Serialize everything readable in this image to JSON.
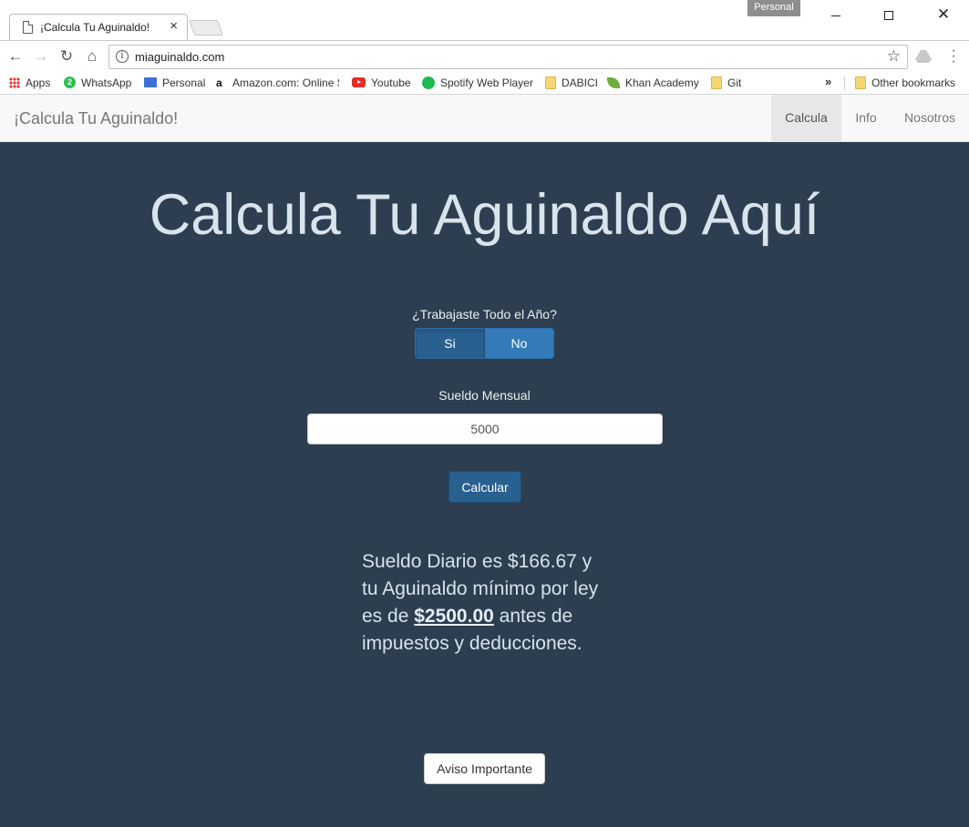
{
  "browser": {
    "tab_title": "¡Calcula Tu Aguinaldo!",
    "tab_close": "×",
    "profile_label": "Personal",
    "url": "miaguinaldo.com",
    "bookmarks": [
      {
        "label": "Apps",
        "icon": "apps-grid-icon"
      },
      {
        "label": "WhatsApp",
        "icon": "whatsapp-icon"
      },
      {
        "label": "Personal",
        "icon": "mail-icon"
      },
      {
        "label": "Amazon.com: Online S",
        "icon": "amazon-icon"
      },
      {
        "label": "Youtube",
        "icon": "youtube-icon"
      },
      {
        "label": "Spotify Web Player",
        "icon": "spotify-icon"
      },
      {
        "label": "DABICI",
        "icon": "folder-icon"
      },
      {
        "label": "Khan Academy",
        "icon": "khan-leaf-icon"
      },
      {
        "label": "Git",
        "icon": "folder-icon"
      }
    ],
    "bookmarks_more": "»",
    "other_bookmarks": "Other bookmarks"
  },
  "site": {
    "brand": "¡Calcula Tu Aguinaldo!",
    "nav": [
      "Calcula",
      "Info",
      "Nosotros"
    ],
    "active_nav": "Calcula"
  },
  "main": {
    "title": "Calcula Tu Aguinaldo Aquí",
    "question": "¿Trabajaste Todo el Año?",
    "toggle_yes": "Si",
    "toggle_no": "No",
    "selected": "Si",
    "salary_label": "Sueldo Mensual",
    "salary_value": "5000",
    "calculate": "Calcular",
    "result_prefix": "Sueldo Diario es $166.67 y tu Aguinaldo mínimo por ley es de ",
    "result_amount": "$2500.00",
    "result_suffix": " antes de impuestos y deducciones.",
    "notice_button": "Aviso Importante"
  },
  "colors": {
    "page_bg": "#2c3e50",
    "primary": "#337ab7",
    "primary_active": "#286090",
    "heading": "#d8e3ec"
  }
}
